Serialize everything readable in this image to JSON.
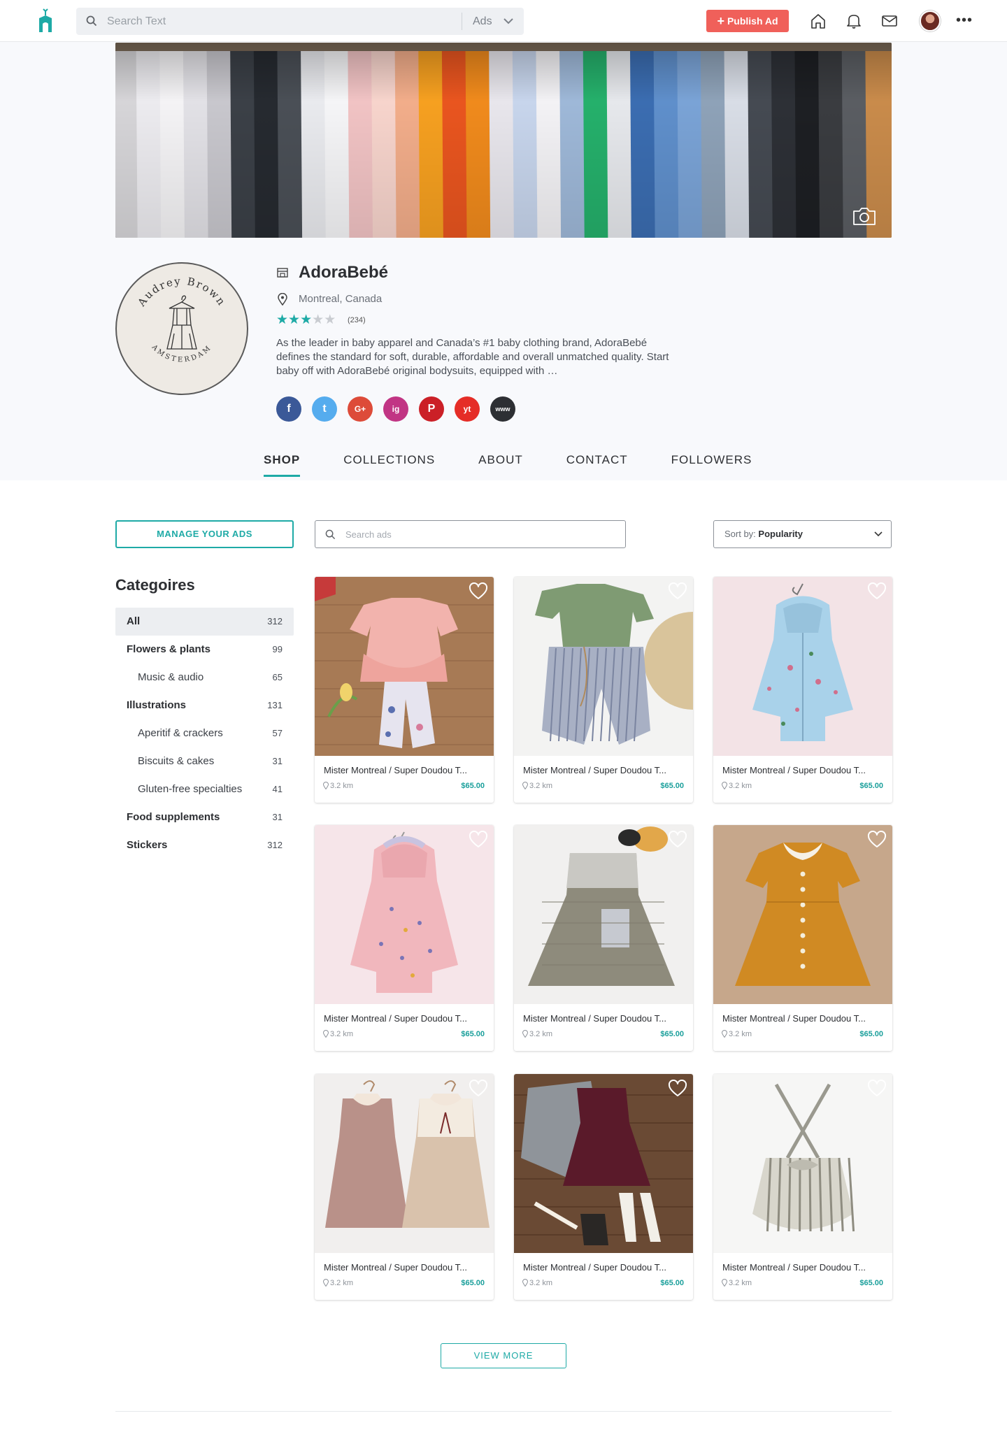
{
  "header": {
    "search_placeholder": "Search Text",
    "search_scope": "Ads",
    "publish_label": "Publish Ad"
  },
  "shop": {
    "name": "AdoraBebé",
    "location": "Montreal, Canada",
    "rating": 3,
    "rating_max": 5,
    "reviews": "(234)",
    "description": "As the leader in baby apparel and Canada’s #1 baby clothing brand, AdoraBebé defines the standard for soft, durable, affordable and overall unmatched quality. Start baby off with AdoraBebé original bodysuits, equipped with …",
    "logo_text_top": "Audrey Brown",
    "logo_text_bottom": "AMSTERDAM",
    "socials": [
      {
        "icon": "facebook-icon",
        "glyph": "f",
        "color": "#3b5998"
      },
      {
        "icon": "twitter-icon",
        "glyph": "t",
        "color": "#55acee"
      },
      {
        "icon": "google-plus-icon",
        "glyph": "G+",
        "color": "#dd4b39"
      },
      {
        "icon": "instagram-icon",
        "glyph": "ig",
        "color": "#c13584"
      },
      {
        "icon": "pinterest-icon",
        "glyph": "P",
        "color": "#cb2027"
      },
      {
        "icon": "youtube-icon",
        "glyph": "yt",
        "color": "#e52d27"
      },
      {
        "icon": "website-icon",
        "glyph": "www",
        "color": "#2d2f33"
      }
    ]
  },
  "tabs": [
    {
      "label": "SHOP",
      "active": true
    },
    {
      "label": "COLLECTIONS",
      "active": false
    },
    {
      "label": "ABOUT",
      "active": false
    },
    {
      "label": "CONTACT",
      "active": false
    },
    {
      "label": "FOLLOWERS",
      "active": false
    }
  ],
  "controls": {
    "manage_label": "MANAGE YOUR ADS",
    "ad_search_placeholder": "Search ads",
    "sort_label": "Sort by:",
    "sort_value": "Popularity"
  },
  "categories": {
    "title": "Categoires",
    "items": [
      {
        "name": "All",
        "count": "312",
        "level": 0,
        "selected": true
      },
      {
        "name": "Flowers & plants",
        "count": "99",
        "level": 0,
        "selected": false
      },
      {
        "name": "Music & audio",
        "count": "65",
        "level": 1,
        "selected": false
      },
      {
        "name": "Illustrations",
        "count": "131",
        "level": 0,
        "selected": false
      },
      {
        "name": "Aperitif & crackers",
        "count": "57",
        "level": 1,
        "selected": false
      },
      {
        "name": "Biscuits & cakes",
        "count": "31",
        "level": 1,
        "selected": false
      },
      {
        "name": "Gluten-free specialties",
        "count": "41",
        "level": 1,
        "selected": false
      },
      {
        "name": "Food supplements",
        "count": "31",
        "level": 0,
        "selected": false
      },
      {
        "name": "Stickers",
        "count": "312",
        "level": 0,
        "selected": false
      }
    ]
  },
  "products": [
    {
      "title": "Mister Montreal / Super Doudou T...",
      "distance": "3.2 km",
      "price": "$65.00",
      "art": "pink-ruffle-outfit"
    },
    {
      "title": "Mister Montreal / Super Doudou T...",
      "distance": "3.2 km",
      "price": "$65.00",
      "art": "green-tee-striped-pants"
    },
    {
      "title": "Mister Montreal / Super Doudou T...",
      "distance": "3.2 km",
      "price": "$65.00",
      "art": "blue-floral-jacket"
    },
    {
      "title": "Mister Montreal / Super Doudou T...",
      "distance": "3.2 km",
      "price": "$65.00",
      "art": "pink-floral-raincoat"
    },
    {
      "title": "Mister Montreal / Super Doudou T...",
      "distance": "3.2 km",
      "price": "$65.00",
      "art": "grey-linen-dress"
    },
    {
      "title": "Mister Montreal / Super Doudou T...",
      "distance": "3.2 km",
      "price": "$65.00",
      "art": "mustard-collar-dress"
    },
    {
      "title": "Mister Montreal / Super Doudou T...",
      "distance": "3.2 km",
      "price": "$65.00",
      "art": "two-floral-dresses"
    },
    {
      "title": "Mister Montreal / Super Doudou T...",
      "distance": "3.2 km",
      "price": "$65.00",
      "art": "plum-dress-cardigan"
    },
    {
      "title": "Mister Montreal / Super Doudou T...",
      "distance": "3.2 km",
      "price": "$65.00",
      "art": "striped-romper"
    }
  ],
  "view_more_label": "VIEW MORE",
  "colors": {
    "accent": "#1eaaa6",
    "publish": "#f0605a",
    "price": "#1a9f9b"
  }
}
